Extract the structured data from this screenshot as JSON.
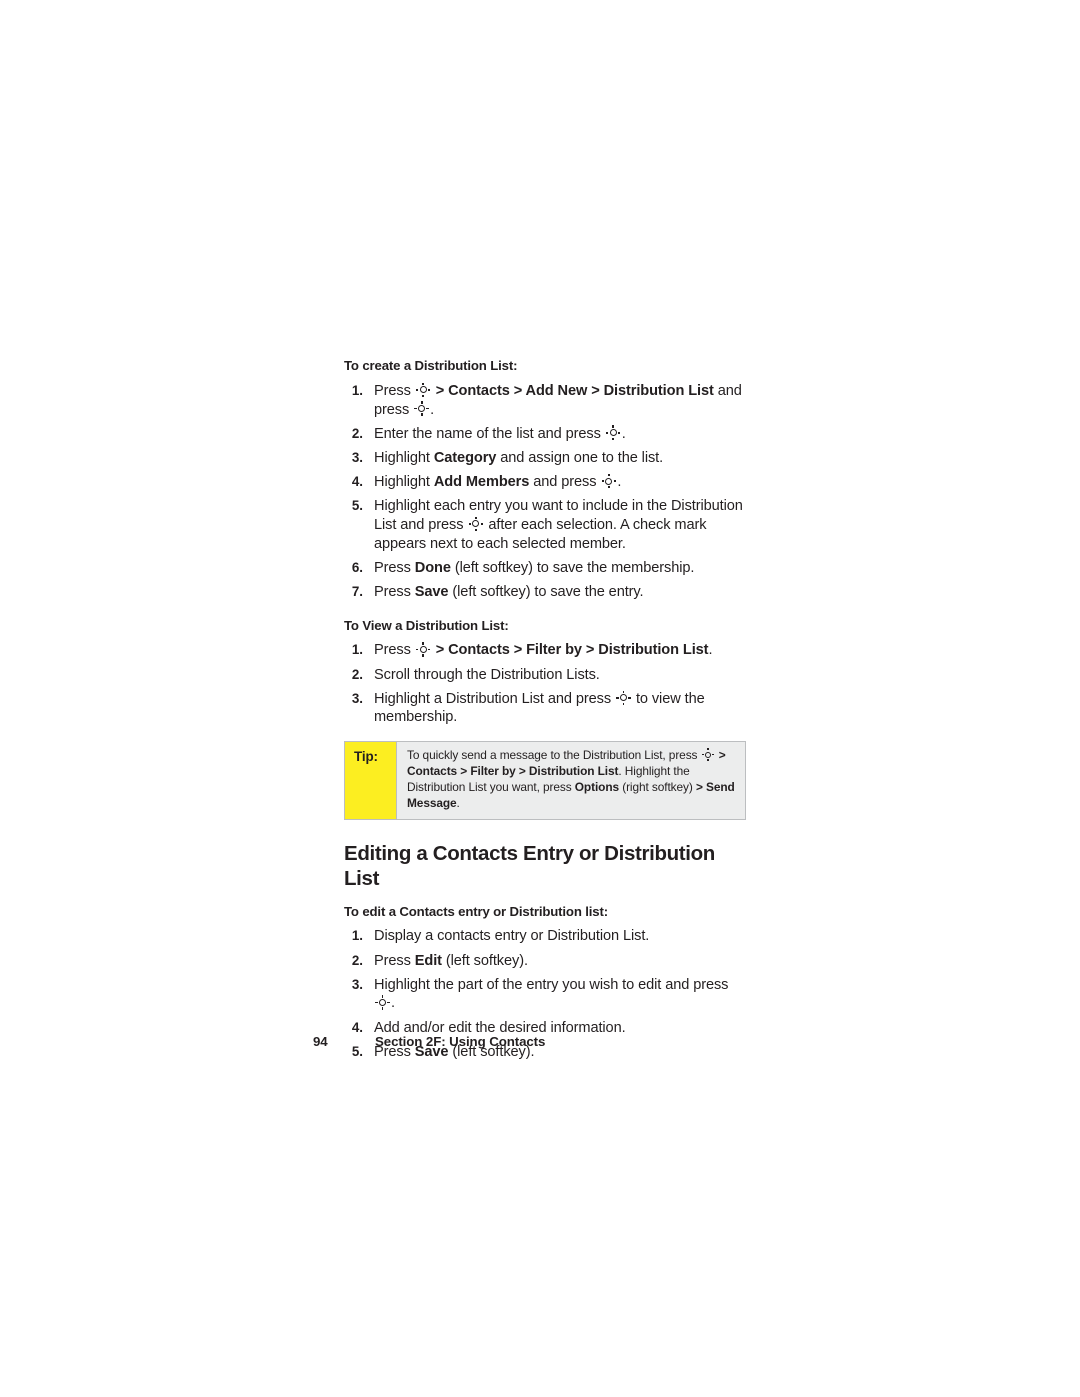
{
  "document": {
    "page_number": "94",
    "footer_section": "Section 2F: Using Contacts"
  },
  "icons": {
    "navigation_key": "navigation-key-icon"
  },
  "colors": {
    "tip_label_background": "#fcee21",
    "tip_body_background": "#eceded",
    "tip_border": "#bcbec0",
    "text": "#231f20",
    "page_background": "#ffffff"
  },
  "sections": [
    {
      "id": "create-distribution-list",
      "heading": "To create a Distribution List:",
      "steps": [
        {
          "num": "1.",
          "parts": [
            {
              "t": "text",
              "v": "Press "
            },
            {
              "t": "icon",
              "v": "navigation-key-icon"
            },
            {
              "t": "bold",
              "v": " > Contacts > Add New > Distribution List"
            },
            {
              "t": "text",
              "v": " and press "
            },
            {
              "t": "icon",
              "v": "navigation-key-icon"
            },
            {
              "t": "text",
              "v": "."
            }
          ]
        },
        {
          "num": "2.",
          "parts": [
            {
              "t": "text",
              "v": "Enter the name of the list and press "
            },
            {
              "t": "icon",
              "v": "navigation-key-icon"
            },
            {
              "t": "text",
              "v": "."
            }
          ]
        },
        {
          "num": "3.",
          "parts": [
            {
              "t": "text",
              "v": "Highlight "
            },
            {
              "t": "bold",
              "v": "Category"
            },
            {
              "t": "text",
              "v": " and assign one to the list."
            }
          ]
        },
        {
          "num": "4.",
          "parts": [
            {
              "t": "text",
              "v": "Highlight "
            },
            {
              "t": "bold",
              "v": "Add Members"
            },
            {
              "t": "text",
              "v": " and press "
            },
            {
              "t": "icon",
              "v": "navigation-key-icon"
            },
            {
              "t": "text",
              "v": "."
            }
          ]
        },
        {
          "num": "5.",
          "parts": [
            {
              "t": "text",
              "v": "Highlight each entry you want to include in the Distribution List and press "
            },
            {
              "t": "icon",
              "v": "navigation-key-icon"
            },
            {
              "t": "text",
              "v": " after each selection. A check mark appears next to each selected member."
            }
          ]
        },
        {
          "num": "6.",
          "parts": [
            {
              "t": "text",
              "v": "Press "
            },
            {
              "t": "bold",
              "v": "Done"
            },
            {
              "t": "text",
              "v": " (left softkey) to save the membership."
            }
          ]
        },
        {
          "num": "7.",
          "parts": [
            {
              "t": "text",
              "v": "Press "
            },
            {
              "t": "bold",
              "v": "Save"
            },
            {
              "t": "text",
              "v": " (left softkey) to save the entry."
            }
          ]
        }
      ]
    },
    {
      "id": "view-distribution-list",
      "heading": "To View a Distribution List:",
      "steps": [
        {
          "num": "1.",
          "parts": [
            {
              "t": "text",
              "v": "Press "
            },
            {
              "t": "icon",
              "v": "navigation-key-icon"
            },
            {
              "t": "bold",
              "v": " > Contacts > Filter by > Distribution List"
            },
            {
              "t": "text",
              "v": "."
            }
          ]
        },
        {
          "num": "2.",
          "parts": [
            {
              "t": "text",
              "v": "Scroll through the Distribution Lists."
            }
          ]
        },
        {
          "num": "3.",
          "parts": [
            {
              "t": "text",
              "v": "Highlight a Distribution List and press "
            },
            {
              "t": "icon",
              "v": "navigation-key-icon"
            },
            {
              "t": "text",
              "v": " to view the membership."
            }
          ]
        }
      ]
    }
  ],
  "tip": {
    "label": "Tip:",
    "parts": [
      {
        "t": "text",
        "v": "To quickly send a message to the Distribution List, press "
      },
      {
        "t": "icon",
        "v": "navigation-key-icon"
      },
      {
        "t": "bold",
        "v": " > Contacts > Filter by > Distribution List"
      },
      {
        "t": "text",
        "v": ". Highlight the Distribution List you want, press "
      },
      {
        "t": "bold",
        "v": "Options"
      },
      {
        "t": "text",
        "v": " (right softkey) "
      },
      {
        "t": "bold",
        "v": "> Send Message"
      },
      {
        "t": "text",
        "v": "."
      }
    ]
  },
  "editing_section": {
    "title": "Editing a Contacts Entry or Distribution List",
    "heading": "To edit a Contacts entry or Distribution list:",
    "steps": [
      {
        "num": "1.",
        "parts": [
          {
            "t": "text",
            "v": "Display a contacts entry or Distribution List."
          }
        ]
      },
      {
        "num": "2.",
        "parts": [
          {
            "t": "text",
            "v": "Press "
          },
          {
            "t": "bold",
            "v": "Edit"
          },
          {
            "t": "text",
            "v": " (left softkey)."
          }
        ]
      },
      {
        "num": "3.",
        "parts": [
          {
            "t": "text",
            "v": "Highlight the part of the entry you wish to edit and press "
          },
          {
            "t": "icon",
            "v": "navigation-key-icon"
          },
          {
            "t": "text",
            "v": "."
          }
        ]
      },
      {
        "num": "4.",
        "parts": [
          {
            "t": "text",
            "v": "Add and/or edit the desired information."
          }
        ]
      },
      {
        "num": "5.",
        "parts": [
          {
            "t": "text",
            "v": "Press "
          },
          {
            "t": "bold",
            "v": "Save"
          },
          {
            "t": "text",
            "v": " (left softkey)."
          }
        ]
      }
    ]
  }
}
